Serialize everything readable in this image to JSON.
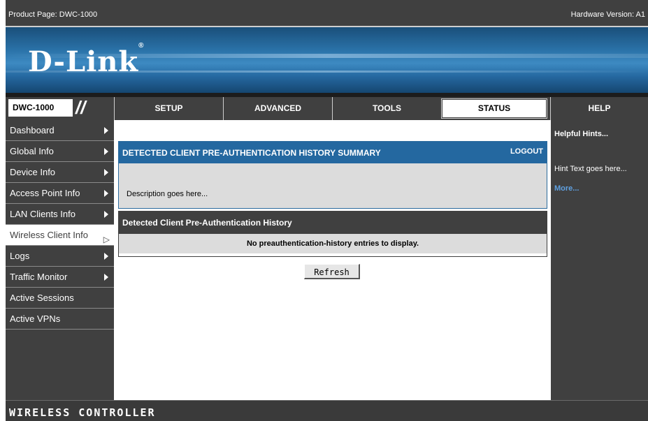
{
  "topbar": {
    "product": "Product Page: DWC-1000",
    "hardware": "Hardware Version: A1"
  },
  "brand": {
    "logo": "D-Link",
    "trademark": "®"
  },
  "nav": {
    "model": "DWC-1000",
    "tabs": [
      {
        "label": "SETUP"
      },
      {
        "label": "ADVANCED"
      },
      {
        "label": "TOOLS"
      },
      {
        "label": "STATUS"
      },
      {
        "label": "HELP"
      }
    ],
    "active_tab": "STATUS"
  },
  "sidebar": {
    "items": [
      {
        "label": "Dashboard"
      },
      {
        "label": "Global Info"
      },
      {
        "label": "Device Info"
      },
      {
        "label": "Access Point Info"
      },
      {
        "label": "LAN Clients Info"
      },
      {
        "label": "Wireless Client Info"
      },
      {
        "label": "Logs"
      },
      {
        "label": "Traffic Monitor"
      },
      {
        "label": "Active Sessions"
      },
      {
        "label": "Active VPNs"
      }
    ],
    "active_item": "Wireless Client Info"
  },
  "summary": {
    "title": "DETECTED CLIENT PRE-AUTHENTICATION HISTORY SUMMARY",
    "logout": "LOGOUT",
    "description": "Description goes here..."
  },
  "history": {
    "title": "Detected Client Pre-Authentication History",
    "empty_message": "No preauthentication-history entries to display.",
    "refresh_label": "Refresh"
  },
  "help": {
    "heading": "Helpful Hints...",
    "hint": "Hint Text goes here...",
    "more": "More..."
  },
  "footer": {
    "label": "WIRELESS CONTROLLER"
  },
  "colors": {
    "dark": "#404040",
    "accent": "#2468a0",
    "link": "#5fa0e0"
  }
}
